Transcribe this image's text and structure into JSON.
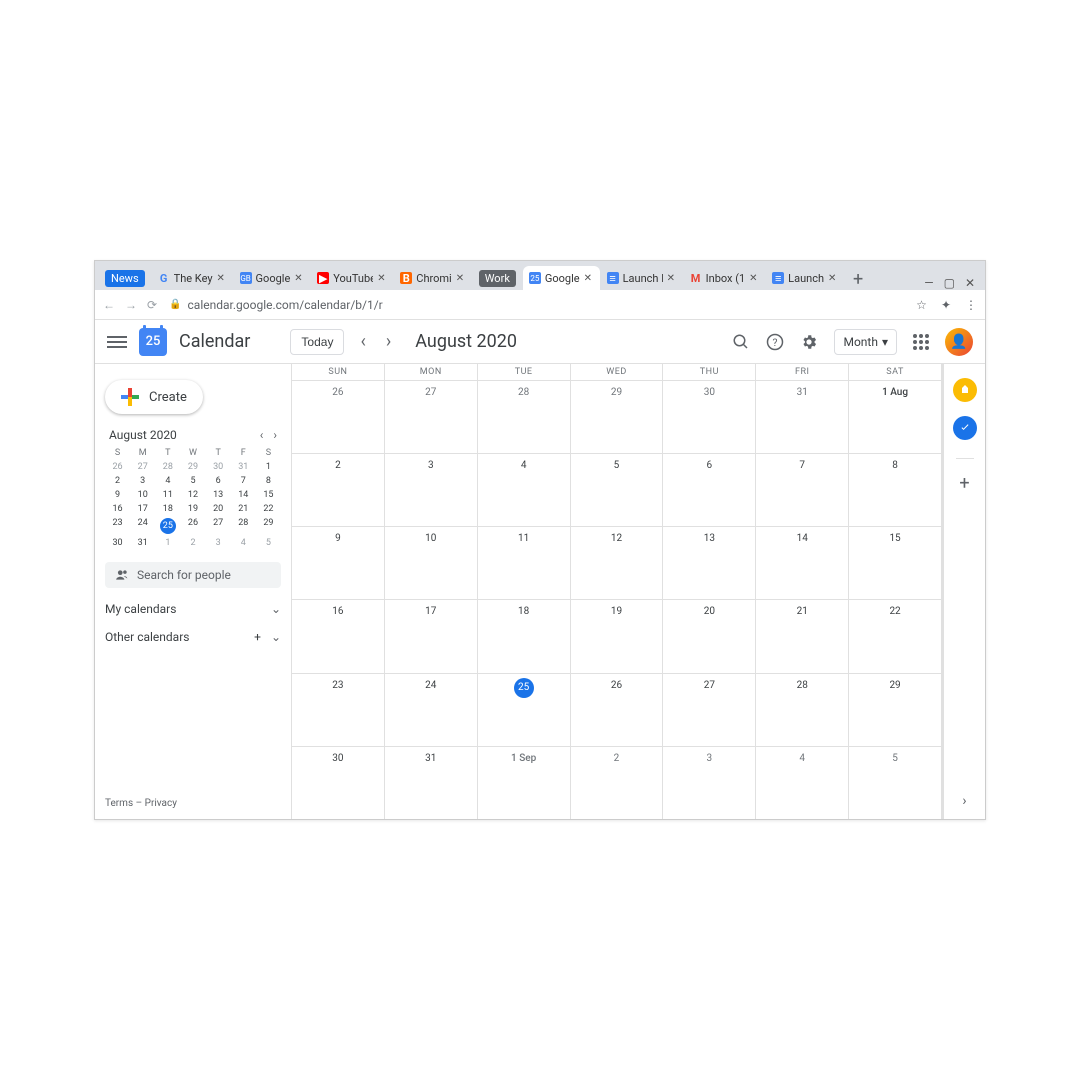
{
  "browser": {
    "url": "calendar.google.com/calendar/b/1/r",
    "tabs": [
      {
        "label": "News",
        "type": "pill"
      },
      {
        "label": "The Key",
        "favicon": "G"
      },
      {
        "label": "Google",
        "favicon": "GB"
      },
      {
        "label": "YouTube",
        "favicon": "YT"
      },
      {
        "label": "Chromi",
        "favicon": "B"
      },
      {
        "label": "Work",
        "type": "dark-pill"
      },
      {
        "label": "Google",
        "favicon": "CAL",
        "active": true
      },
      {
        "label": "Launch Pr",
        "favicon": "DOC"
      },
      {
        "label": "Inbox (1",
        "favicon": "M"
      },
      {
        "label": "Launch",
        "favicon": "DOC"
      }
    ]
  },
  "header": {
    "app_name": "Calendar",
    "logo_day": "25",
    "today_label": "Today",
    "month_title": "August 2020",
    "view_label": "Month"
  },
  "sidebar": {
    "create_label": "Create",
    "mini_title": "August 2020",
    "dow": [
      "S",
      "M",
      "T",
      "W",
      "T",
      "F",
      "S"
    ],
    "mini_weeks": [
      [
        {
          "d": "26",
          "m": true
        },
        {
          "d": "27",
          "m": true
        },
        {
          "d": "28",
          "m": true
        },
        {
          "d": "29",
          "m": true
        },
        {
          "d": "30",
          "m": true
        },
        {
          "d": "31",
          "m": true
        },
        {
          "d": "1"
        }
      ],
      [
        {
          "d": "2"
        },
        {
          "d": "3"
        },
        {
          "d": "4"
        },
        {
          "d": "5"
        },
        {
          "d": "6"
        },
        {
          "d": "7"
        },
        {
          "d": "8"
        }
      ],
      [
        {
          "d": "9"
        },
        {
          "d": "10"
        },
        {
          "d": "11"
        },
        {
          "d": "12"
        },
        {
          "d": "13"
        },
        {
          "d": "14"
        },
        {
          "d": "15"
        }
      ],
      [
        {
          "d": "16"
        },
        {
          "d": "17"
        },
        {
          "d": "18"
        },
        {
          "d": "19"
        },
        {
          "d": "20"
        },
        {
          "d": "21"
        },
        {
          "d": "22"
        }
      ],
      [
        {
          "d": "23"
        },
        {
          "d": "24"
        },
        {
          "d": "25",
          "today": true
        },
        {
          "d": "26"
        },
        {
          "d": "27"
        },
        {
          "d": "28"
        },
        {
          "d": "29"
        }
      ],
      [
        {
          "d": "30"
        },
        {
          "d": "31"
        },
        {
          "d": "1",
          "m": true
        },
        {
          "d": "2",
          "m": true
        },
        {
          "d": "3",
          "m": true
        },
        {
          "d": "4",
          "m": true
        },
        {
          "d": "5",
          "m": true
        }
      ]
    ],
    "search_placeholder": "Search for people",
    "my_calendars": "My calendars",
    "other_calendars": "Other calendars",
    "terms": "Terms",
    "privacy": "Privacy"
  },
  "grid": {
    "dow": [
      "SUN",
      "MON",
      "TUE",
      "WED",
      "THU",
      "FRI",
      "SAT"
    ],
    "weeks": [
      [
        {
          "d": "26",
          "m": true
        },
        {
          "d": "27",
          "m": true
        },
        {
          "d": "28",
          "m": true
        },
        {
          "d": "29",
          "m": true
        },
        {
          "d": "30",
          "m": true
        },
        {
          "d": "31",
          "m": true
        },
        {
          "d": "1 Aug",
          "first": true
        }
      ],
      [
        {
          "d": "2"
        },
        {
          "d": "3"
        },
        {
          "d": "4"
        },
        {
          "d": "5"
        },
        {
          "d": "6"
        },
        {
          "d": "7"
        },
        {
          "d": "8"
        }
      ],
      [
        {
          "d": "9"
        },
        {
          "d": "10"
        },
        {
          "d": "11"
        },
        {
          "d": "12"
        },
        {
          "d": "13"
        },
        {
          "d": "14"
        },
        {
          "d": "15"
        }
      ],
      [
        {
          "d": "16"
        },
        {
          "d": "17"
        },
        {
          "d": "18"
        },
        {
          "d": "19"
        },
        {
          "d": "20"
        },
        {
          "d": "21"
        },
        {
          "d": "22"
        }
      ],
      [
        {
          "d": "23"
        },
        {
          "d": "24"
        },
        {
          "d": "25",
          "today": true
        },
        {
          "d": "26"
        },
        {
          "d": "27"
        },
        {
          "d": "28"
        },
        {
          "d": "29"
        }
      ],
      [
        {
          "d": "30"
        },
        {
          "d": "31"
        },
        {
          "d": "1 Sep",
          "m": true,
          "first": true
        },
        {
          "d": "2",
          "m": true
        },
        {
          "d": "3",
          "m": true
        },
        {
          "d": "4",
          "m": true
        },
        {
          "d": "5",
          "m": true
        }
      ]
    ]
  }
}
